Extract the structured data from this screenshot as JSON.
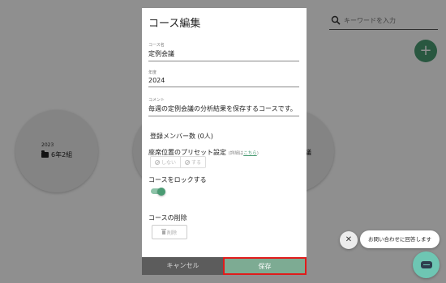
{
  "background": {
    "search": {
      "placeholder": "キーワードを入力",
      "icon": "search-icon"
    },
    "fab": {
      "label": "+",
      "icon": "plus-icon"
    },
    "courses": [
      {
        "year": "2023",
        "name": "6年2組",
        "icon": "folder-icon"
      },
      {
        "name": "議"
      }
    ]
  },
  "modal": {
    "title": "コース編集",
    "fields": {
      "name": {
        "label": "コース名",
        "value": "定例会議"
      },
      "year": {
        "label": "年度",
        "value": "2024"
      },
      "comment": {
        "label": "コメント",
        "value": "毎週の定例会議の分析結果を保存するコースです。"
      }
    },
    "members_label": "登録メンバー数 (0人)",
    "preset": {
      "label": "座席位置のプリセット設定",
      "note_prefix": "(詳細は",
      "note_link": "こちら",
      "note_suffix": ")",
      "options": [
        "しない",
        "する"
      ]
    },
    "lock": {
      "label": "コースをロックする",
      "enabled": true
    },
    "delete": {
      "section_label": "コースの削除",
      "button_label": "削除"
    },
    "buttons": {
      "cancel": "キャンセル",
      "save": "保存"
    }
  },
  "chat": {
    "close_label": "✕",
    "bubble_text": "お問い合わせに回答します"
  },
  "colors": {
    "accent": "#4a9b73",
    "save_button": "#7dab93",
    "highlight_border": "#e01b1b",
    "chat_button": "#6ec6b3"
  }
}
